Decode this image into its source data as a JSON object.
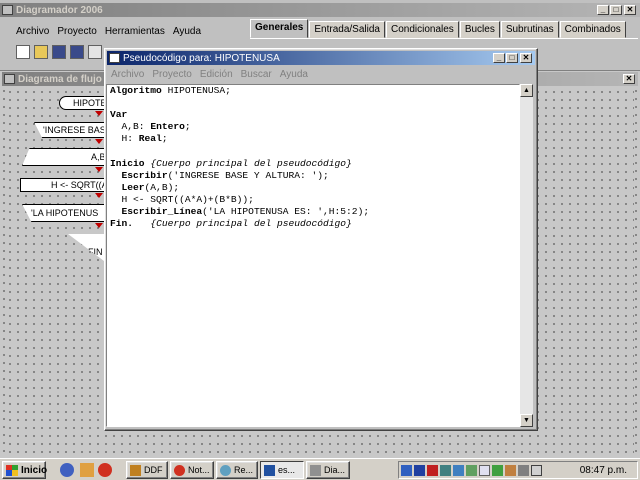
{
  "main_window": {
    "title": "Diagramador 2006",
    "menu": [
      "Archivo",
      "Proyecto",
      "Herramientas",
      "Ayuda"
    ],
    "tabs": [
      "Generales",
      "Entrada/Salida",
      "Condicionales",
      "Bucles",
      "Subrutinas",
      "Combinados"
    ],
    "selected_tab": "Generales"
  },
  "diagram_window": {
    "title": "Diagrama de flujo",
    "shapes": [
      "HIPOTE",
      "'INGRESE BASE",
      "A,B",
      "H <- SQRT((A",
      "'LA HIPOTENUS",
      "FIN"
    ]
  },
  "pseudo_window": {
    "title": "Pseudocódigo para: HIPOTENUSA",
    "menu": [
      "Archivo",
      "Proyecto",
      "Edición",
      "Buscar",
      "Ayuda"
    ],
    "lines": [
      [
        {
          "t": "Algoritmo",
          "s": "kw"
        },
        {
          "t": " HIPOTENUSA;",
          "s": "n"
        }
      ],
      [],
      [
        {
          "t": "Var",
          "s": "kw"
        }
      ],
      [
        {
          "t": "  A,B: ",
          "s": "n"
        },
        {
          "t": "Entero",
          "s": "kw"
        },
        {
          "t": ";",
          "s": "n"
        }
      ],
      [
        {
          "t": "  H: ",
          "s": "n"
        },
        {
          "t": "Real",
          "s": "kw"
        },
        {
          "t": ";",
          "s": "n"
        }
      ],
      [],
      [
        {
          "t": "Inicio",
          "s": "kw"
        },
        {
          "t": " ",
          "s": "n"
        },
        {
          "t": "{Cuerpo principal del pseudocódigo}",
          "s": "cm"
        }
      ],
      [
        {
          "t": "  ",
          "s": "n"
        },
        {
          "t": "Escribir",
          "s": "kw"
        },
        {
          "t": "('INGRESE BASE Y ALTURA: ');",
          "s": "n"
        }
      ],
      [
        {
          "t": "  ",
          "s": "n"
        },
        {
          "t": "Leer",
          "s": "kw"
        },
        {
          "t": "(A,B);",
          "s": "n"
        }
      ],
      [
        {
          "t": "  H <- SQRT((A*A)+(B*B));",
          "s": "n"
        }
      ],
      [
        {
          "t": "  ",
          "s": "n"
        },
        {
          "t": "Escribir_Línea",
          "s": "kw"
        },
        {
          "t": "('LA HIPOTENUSA ES: ',H:5:2);",
          "s": "n"
        }
      ],
      [
        {
          "t": "Fin.",
          "s": "kw"
        },
        {
          "t": "   ",
          "s": "n"
        },
        {
          "t": "{Cuerpo principal del pseudocódigo}",
          "s": "cm"
        }
      ]
    ]
  },
  "taskbar": {
    "start_label": "Inicio",
    "buttons": [
      "DDF",
      "Not...",
      "Re...",
      "es...",
      "Dia..."
    ],
    "active_button": "es...",
    "clock": "08:47 p.m."
  },
  "colors": {
    "active_title": "#0a246a",
    "inactive_title": "#808080",
    "flow_arrow": "#c00000"
  }
}
